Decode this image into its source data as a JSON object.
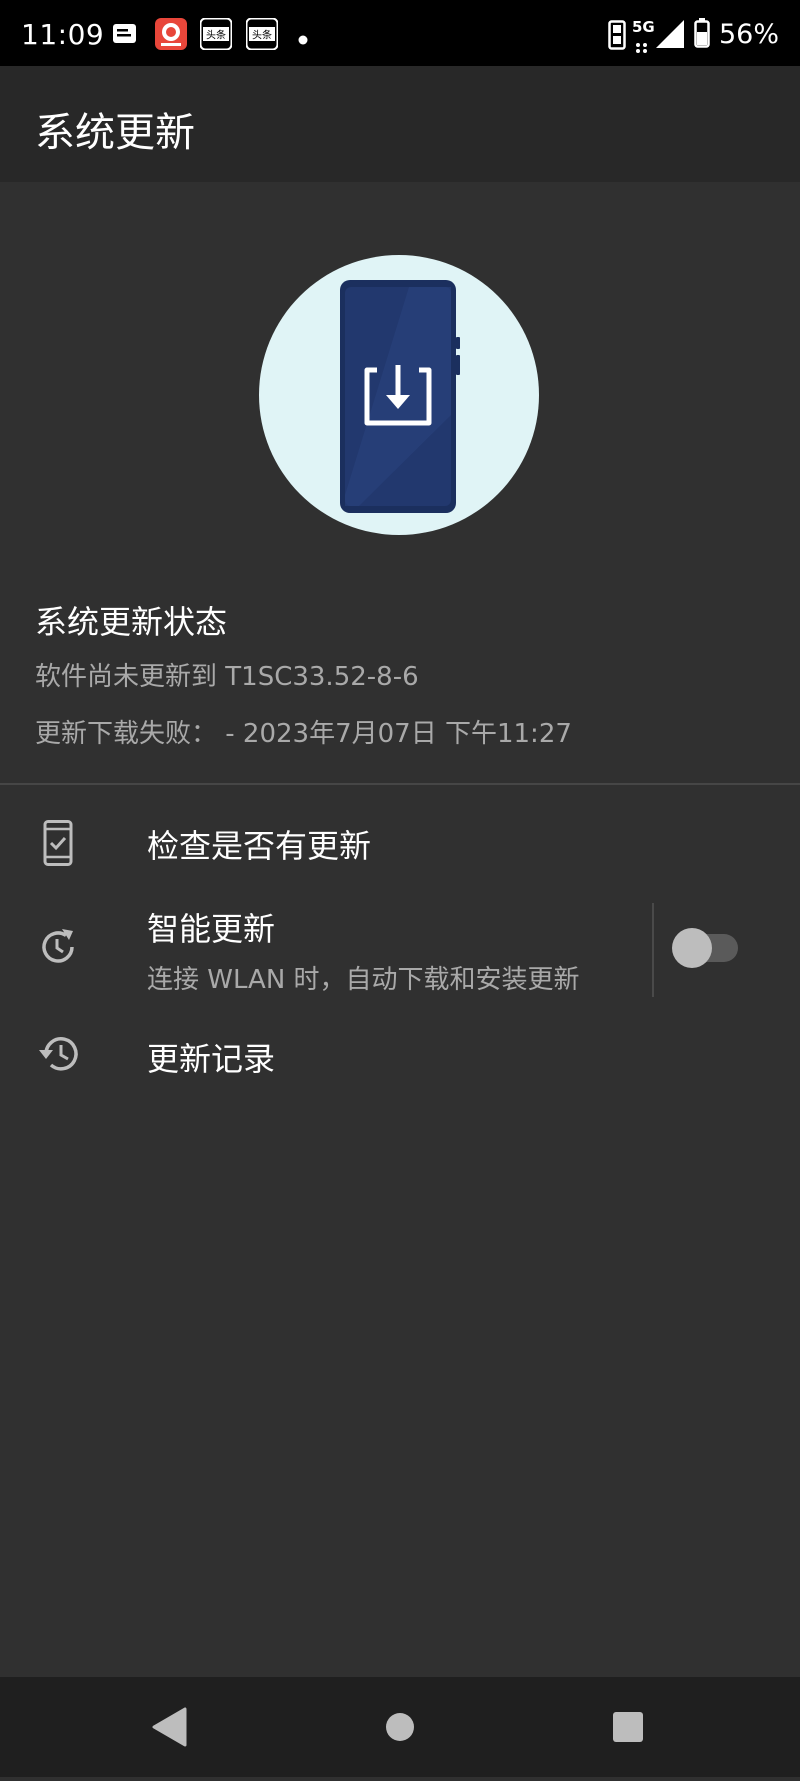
{
  "status_bar": {
    "time": "11:09",
    "notification_icons": [
      "message-icon",
      "app-icon",
      "toutiao-icon",
      "toutiao-icon",
      "dot-icon"
    ],
    "notification_labels": [
      "头条",
      "头条"
    ],
    "network": "5G",
    "battery": "56%"
  },
  "app_bar": {
    "title": "系统更新"
  },
  "status_section": {
    "title": "系统更新状态",
    "line1": "软件尚未更新到 T1SC33.52-8-6",
    "line2": "更新下载失败： - 2023年7月07日 下午11:27"
  },
  "menu": {
    "check_updates": {
      "title": "检查是否有更新",
      "icon": "phone-check-icon"
    },
    "smart_update": {
      "title": "智能更新",
      "subtitle": "连接 WLAN 时，自动下载和安装更新",
      "icon": "schedule-update-icon",
      "toggle_on": false
    },
    "history": {
      "title": "更新记录",
      "icon": "history-icon"
    }
  },
  "colors": {
    "background": "#303030",
    "app_bar": "#282828",
    "hero_circle": "#e0f4f6",
    "phone_body": "#1f3566"
  }
}
